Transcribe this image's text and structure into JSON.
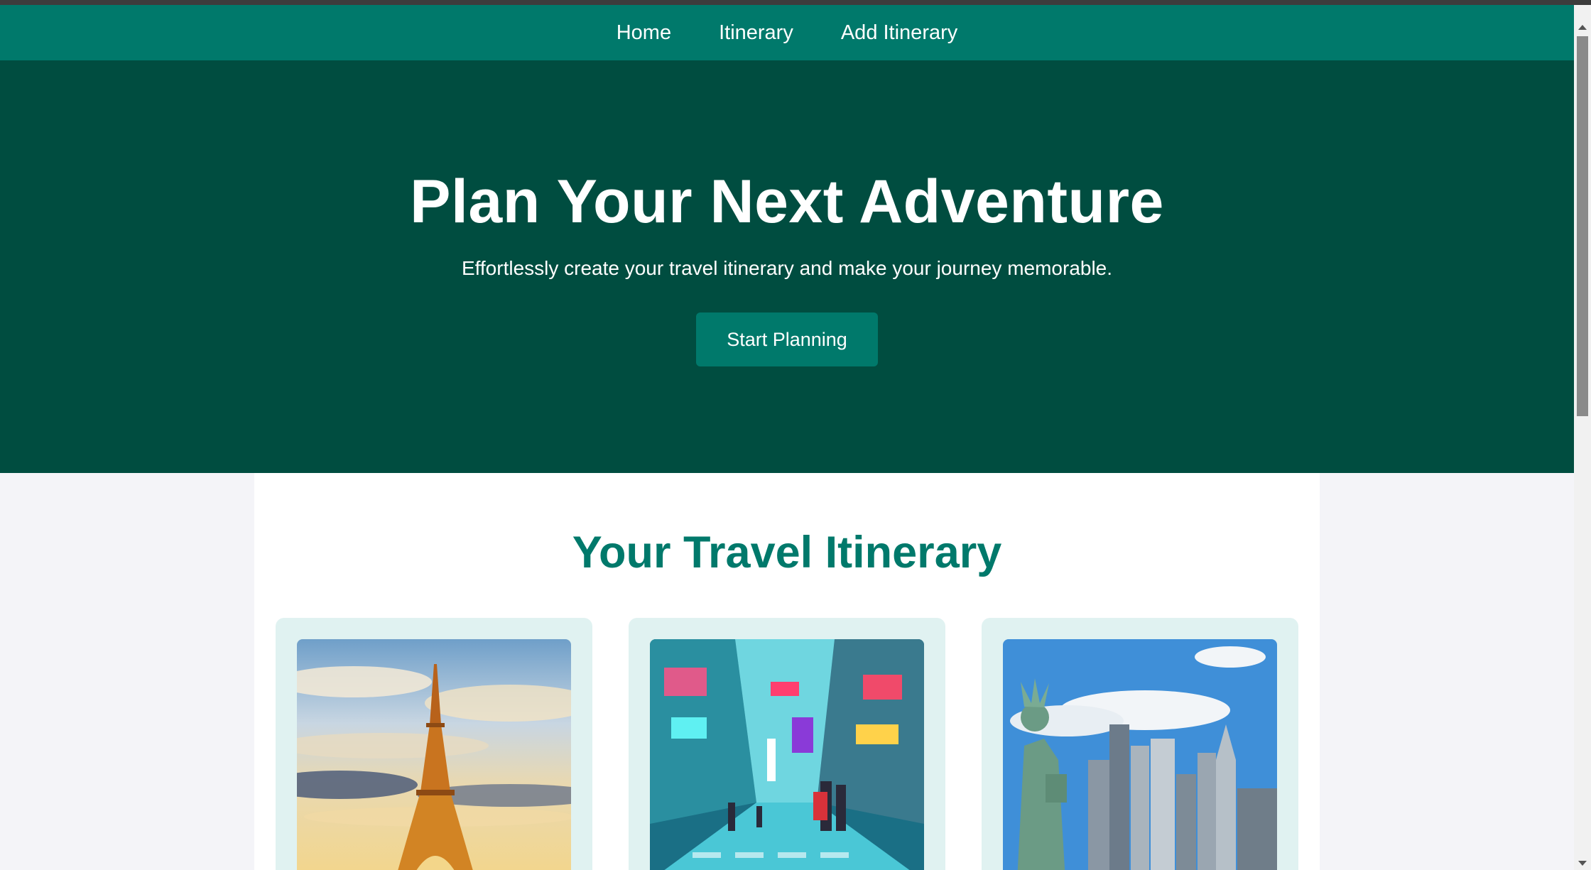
{
  "nav": {
    "items": [
      {
        "label": "Home"
      },
      {
        "label": "Itinerary"
      },
      {
        "label": "Add Itinerary"
      }
    ]
  },
  "hero": {
    "title": "Plan Your Next Adventure",
    "subtitle": "Effortlessly create your travel itinerary and make your journey memorable.",
    "button_label": "Start Planning"
  },
  "itinerary": {
    "heading": "Your Travel Itinerary",
    "cards": [
      {
        "image": "eiffel-tower-photo"
      },
      {
        "image": "neon-city-street-photo"
      },
      {
        "image": "statue-of-liberty-skyline-photo"
      }
    ]
  },
  "colors": {
    "nav_bg": "#00796b",
    "hero_bg": "#004d40",
    "accent": "#00796b",
    "card_bg": "#e0f2f1",
    "page_bg": "#f4f4f8"
  }
}
